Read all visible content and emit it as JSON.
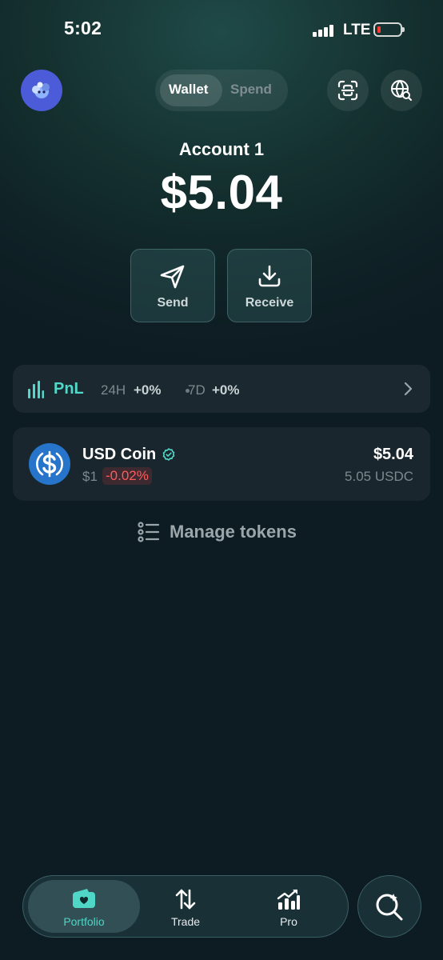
{
  "status_bar": {
    "time": "5:02",
    "network": "LTE",
    "signal_bars": 4,
    "battery_level": 0.1,
    "battery_color": "#ff3b30"
  },
  "header": {
    "avatar_icon": "blob-avatar-icon",
    "segments": [
      {
        "label": "Wallet",
        "active": true
      },
      {
        "label": "Spend",
        "active": false
      }
    ],
    "scan_icon": "scan-icon",
    "globe_icon": "globe-search-icon"
  },
  "account": {
    "name": "Account 1",
    "balance": "$5.04"
  },
  "actions": {
    "send_label": "Send",
    "send_icon": "send-icon",
    "receive_label": "Receive",
    "receive_icon": "download-icon"
  },
  "pnl": {
    "title": "PnL",
    "periods": [
      {
        "label": "24H",
        "value": "+0%"
      },
      {
        "label": "7D",
        "value": "+0%"
      }
    ],
    "accent": "#52d8c8"
  },
  "tokens": [
    {
      "name": "USD Coin",
      "verified": true,
      "price": "$1",
      "change": "-0.02%",
      "value": "$5.04",
      "amount": "5.05 USDC",
      "icon": "usdc-icon",
      "brand_color": "#2775ca"
    }
  ],
  "manage_tokens_label": "Manage tokens",
  "bottom_nav": {
    "items": [
      {
        "label": "Portfolio",
        "icon": "wallet-icon",
        "active": true
      },
      {
        "label": "Trade",
        "icon": "arrows-up-down-icon",
        "active": false
      },
      {
        "label": "Pro",
        "icon": "chart-up-icon",
        "active": false
      }
    ],
    "search_icon": "sparkle-search-icon",
    "active_color": "#4fd6c6"
  }
}
